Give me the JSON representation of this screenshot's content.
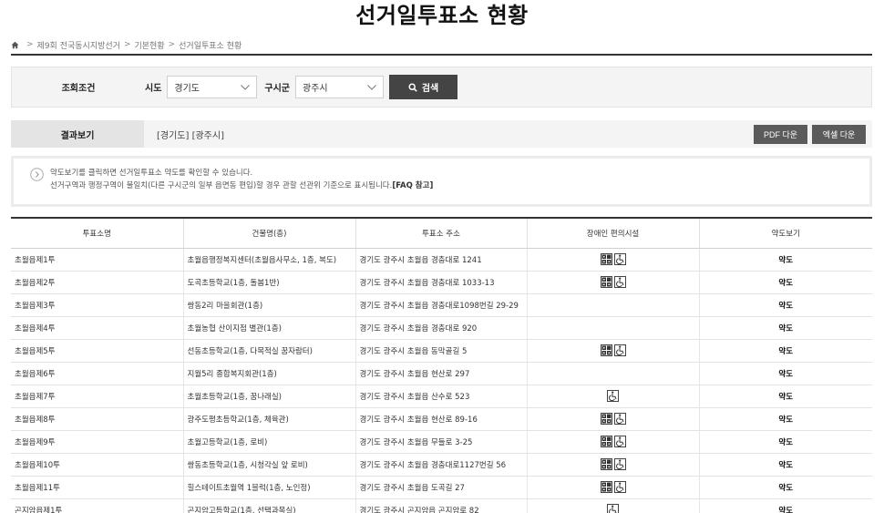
{
  "page": {
    "title": "선거일투표소 현황"
  },
  "breadcrumb": {
    "home_icon": "home-icon",
    "items": [
      "제9회 전국동시지방선거",
      "기본현황",
      "선거일투표소 현황"
    ]
  },
  "search": {
    "condition_label": "조회조건",
    "sido_label": "시도",
    "sido_value": "경기도",
    "gu_label": "구시군",
    "gu_value": "광주시",
    "search_button": "검색"
  },
  "result": {
    "label": "결과보기",
    "value": "[경기도] [광주시]",
    "pdf_button": "PDF 다운",
    "excel_button": "엑셀 다운"
  },
  "notice": {
    "line1": "약도보기를 클릭하면 선거일투표소 약도를 확인할 수 있습니다.",
    "line2": "선거구역과 행정구역이 불일치(다른 구시군의 일부 읍면동 편입)할 경우 관할 선관위 기준으로 표시됩니다.",
    "faq_link": "[FAQ 참고]"
  },
  "table": {
    "headers": [
      "투표소명",
      "건물명(층)",
      "투표소 주소",
      "장애인 편의시설",
      "약도보기"
    ],
    "rows": [
      {
        "name": "초월읍제1투",
        "building": "초월읍행정복지센터(초월읍사무소, 1층, 복도)",
        "address": "경기도 광주시 초월읍 경충대로 1241",
        "facilities": [
          "braille",
          "wheelchair"
        ],
        "map": "약도"
      },
      {
        "name": "초월읍제2투",
        "building": "도곡초등학교(1층, 돌봄1반)",
        "address": "경기도 광주시 초월읍 경충대로 1033-13",
        "facilities": [
          "braille",
          "wheelchair"
        ],
        "map": "약도"
      },
      {
        "name": "초월읍제3투",
        "building": "쌍동2리 마을회관(1층)",
        "address": "경기도 광주시 초월읍 경충대로1098번길 29-29",
        "facilities": [],
        "map": "약도"
      },
      {
        "name": "초월읍제4투",
        "building": "초월농협 산이지점 별관(1층)",
        "address": "경기도 광주시 초월읍 경충대로 920",
        "facilities": [],
        "map": "약도"
      },
      {
        "name": "초월읍제5투",
        "building": "선동초등학교(1층, 다목적실 꿈자람터)",
        "address": "경기도 광주시 초월읍 동막골길 5",
        "facilities": [
          "braille",
          "wheelchair"
        ],
        "map": "약도"
      },
      {
        "name": "초월읍제6투",
        "building": "지월5리 종합복지회관(1층)",
        "address": "경기도 광주시 초월읍 현산로 297",
        "facilities": [],
        "map": "약도"
      },
      {
        "name": "초월읍제7투",
        "building": "초월초등학교(1층, 꿈나래실)",
        "address": "경기도 광주시 초월읍 산수로 523",
        "facilities": [
          "wheelchair"
        ],
        "map": "약도"
      },
      {
        "name": "초월읍제8투",
        "building": "광주도평초등학교(1층, 체육관)",
        "address": "경기도 광주시 초월읍 현산로 89-16",
        "facilities": [
          "braille",
          "wheelchair"
        ],
        "map": "약도"
      },
      {
        "name": "초월읍제9투",
        "building": "초월고등학교(1층, 로비)",
        "address": "경기도 광주시 초월읍 무들로 3-25",
        "facilities": [
          "braille",
          "wheelchair"
        ],
        "map": "약도"
      },
      {
        "name": "초월읍제10투",
        "building": "쌍동초등학교(1층, 시청각실 앞 로비)",
        "address": "경기도 광주시 초월읍 경충대로1127번길 56",
        "facilities": [
          "braille",
          "wheelchair"
        ],
        "map": "약도"
      },
      {
        "name": "초월읍제11투",
        "building": "힐스테이트초월역 1블럭(1층, 노인정)",
        "address": "경기도 광주시 초월읍 도곡길 27",
        "facilities": [
          "braille",
          "wheelchair"
        ],
        "map": "약도"
      },
      {
        "name": "곤지암읍제1투",
        "building": "곤지암고등학교(1층, 선택과목실)",
        "address": "경기도 광주시 곤지암읍 곤지암로 82",
        "facilities": [
          "wheelchair"
        ],
        "map": "약도"
      }
    ]
  }
}
